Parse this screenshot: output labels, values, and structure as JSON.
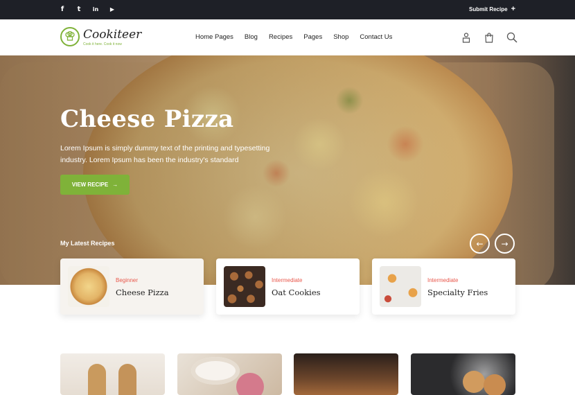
{
  "topbar": {
    "social": [
      {
        "icon": "facebook-icon",
        "glyph": "f"
      },
      {
        "icon": "twitter-icon",
        "glyph": "t"
      },
      {
        "icon": "linkedin-icon",
        "glyph": "in"
      },
      {
        "icon": "youtube-icon",
        "glyph": "▶"
      }
    ],
    "submit_label": "Submit Recipe",
    "submit_icon": "+"
  },
  "header": {
    "logo_text": "Cookiteer",
    "logo_tagline": "Cook it here. Cook it now",
    "nav": [
      "Home Pages",
      "Blog",
      "Recipes",
      "Pages",
      "Shop",
      "Contact Us"
    ],
    "icons": [
      "user-icon",
      "shopping-bag-icon",
      "search-icon"
    ]
  },
  "hero": {
    "title": "Cheese Pizza",
    "description": "Lorem Ipsum is simply dummy text of the printing and typesetting industry. Lorem Ipsum has been the industry's standard",
    "button_label": "VIEW RECIPE",
    "button_icon": "→",
    "latest_label": "My Latest Recipes",
    "prev_icon": "←",
    "next_icon": "→"
  },
  "recipes": [
    {
      "level": "Beginner",
      "name": "Cheese Pizza"
    },
    {
      "level": "Intermediate",
      "name": "Oat Cookies"
    },
    {
      "level": "Intermediate",
      "name": "Specialty Fries"
    }
  ],
  "colors": {
    "accent": "#7fb239",
    "level": "#e8564a",
    "topbar": "#1e2027"
  }
}
